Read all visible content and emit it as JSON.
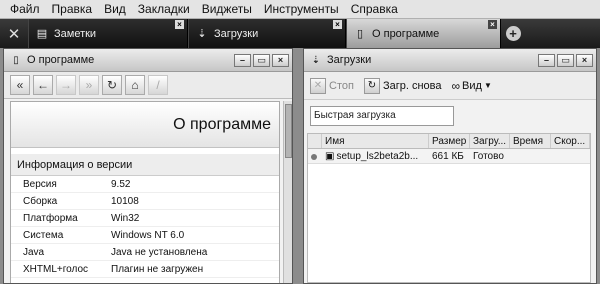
{
  "menu": [
    "Файл",
    "Правка",
    "Вид",
    "Закладки",
    "Виджеты",
    "Инструменты",
    "Справка"
  ],
  "tabs": [
    {
      "label": "Заметки",
      "active": false
    },
    {
      "label": "Загрузки",
      "active": false
    },
    {
      "label": "О программе",
      "active": true
    }
  ],
  "left_panel": {
    "title": "О программе",
    "page_heading": "О программе",
    "section_title": "Информация о версии",
    "rows": [
      {
        "key": "Версия",
        "value": "9.52"
      },
      {
        "key": "Сборка",
        "value": "10108"
      },
      {
        "key": "Платформа",
        "value": "Win32"
      },
      {
        "key": "Система",
        "value": "Windows NT 6.0"
      },
      {
        "key": "Java",
        "value": "Java не установлена"
      },
      {
        "key": "XHTML+голос",
        "value": "Плагин не загружен"
      }
    ]
  },
  "right_panel": {
    "title": "Загрузки",
    "stop_label": "Стоп",
    "retry_label": "Загр. снова",
    "view_label": "Вид",
    "quick_placeholder": "Быстрая загрузка",
    "columns": [
      "Имя",
      "Размер",
      "Загру...",
      "Время",
      "Скор..."
    ],
    "rows": [
      {
        "name": "setup_ls2beta2b...",
        "size": "661 КБ",
        "status": "Готово",
        "time": "",
        "speed": ""
      }
    ]
  }
}
